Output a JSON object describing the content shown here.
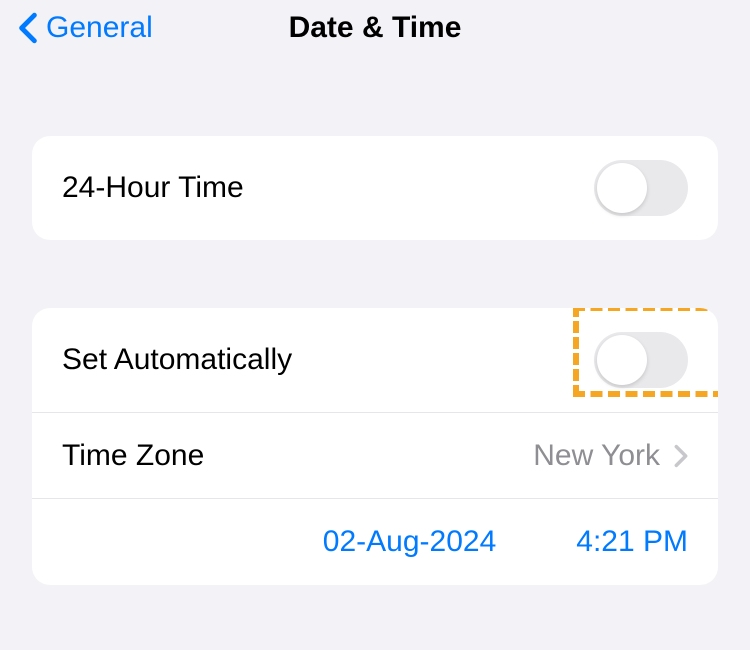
{
  "nav": {
    "back_label": "General",
    "title": "Date & Time"
  },
  "group1": {
    "row1_label": "24-Hour Time"
  },
  "group2": {
    "row1_label": "Set Automatically",
    "row2_label": "Time Zone",
    "row2_value": "New York",
    "date_value": "02-Aug-2024",
    "time_value": "4:21 PM"
  }
}
